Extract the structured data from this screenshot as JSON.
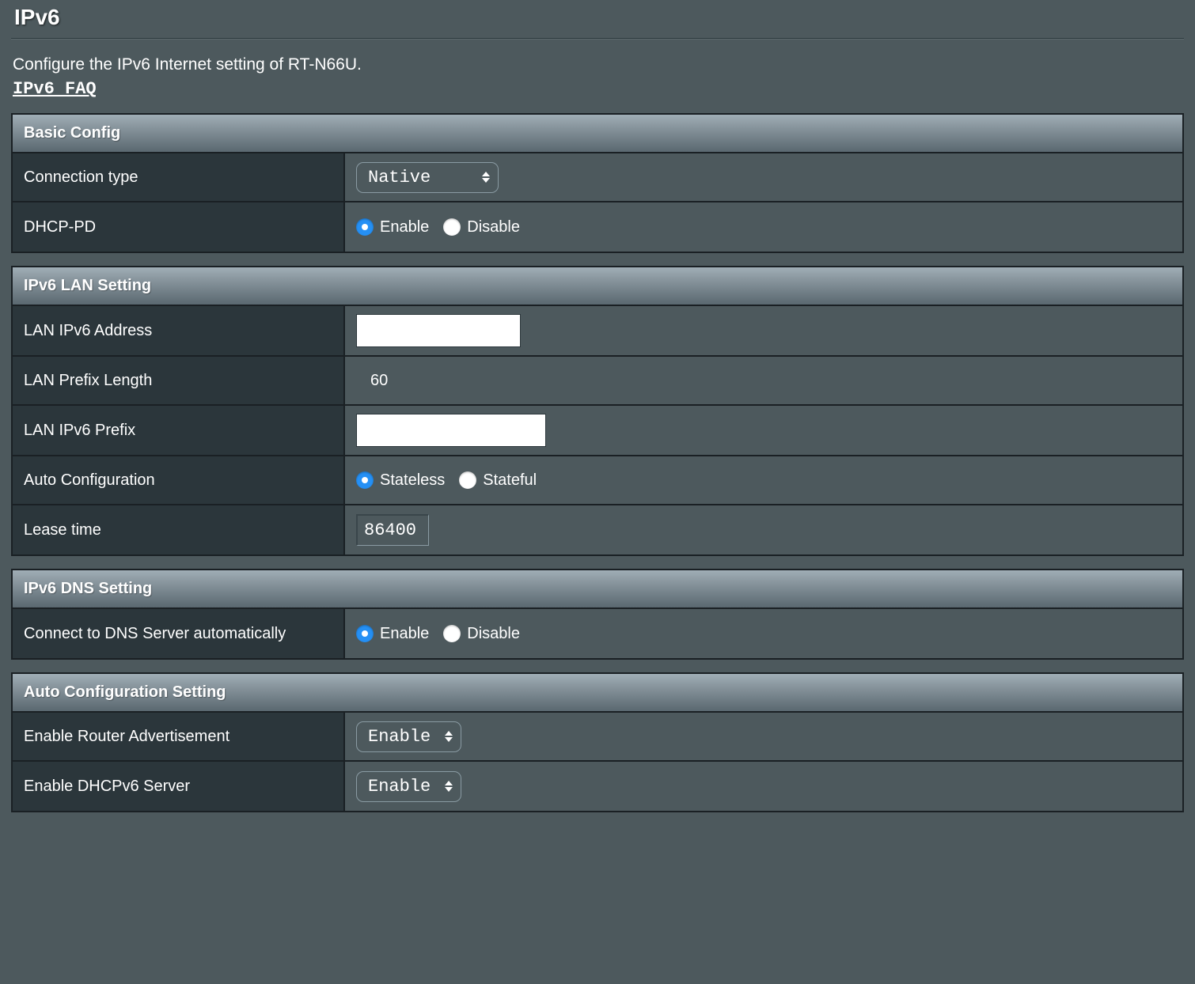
{
  "page": {
    "title": "IPv6",
    "intro": "Configure the IPv6 Internet setting of RT-N66U.",
    "faq_link": "IPv6 FAQ"
  },
  "sections": {
    "basic": {
      "header": "Basic Config",
      "connection_type_label": "Connection type",
      "connection_type_value": "Native",
      "dhcp_pd_label": "DHCP-PD",
      "dhcp_pd_enable": "Enable",
      "dhcp_pd_disable": "Disable"
    },
    "lan": {
      "header": "IPv6 LAN Setting",
      "lan_addr_label": "LAN IPv6 Address",
      "lan_addr_value": "",
      "lan_prefix_len_label": "LAN Prefix Length",
      "lan_prefix_len_value": "60",
      "lan_prefix_label": "LAN IPv6 Prefix",
      "lan_prefix_value": "",
      "auto_conf_label": "Auto Configuration",
      "auto_conf_stateless": "Stateless",
      "auto_conf_stateful": "Stateful",
      "lease_time_label": "Lease time",
      "lease_time_value": "86400"
    },
    "dns": {
      "header": "IPv6 DNS Setting",
      "auto_dns_label": "Connect to DNS Server automatically",
      "auto_dns_enable": "Enable",
      "auto_dns_disable": "Disable"
    },
    "auto": {
      "header": "Auto Configuration Setting",
      "ra_label": "Enable Router Advertisement",
      "ra_value": "Enable",
      "dhcpv6_label": "Enable DHCPv6 Server",
      "dhcpv6_value": "Enable"
    }
  }
}
